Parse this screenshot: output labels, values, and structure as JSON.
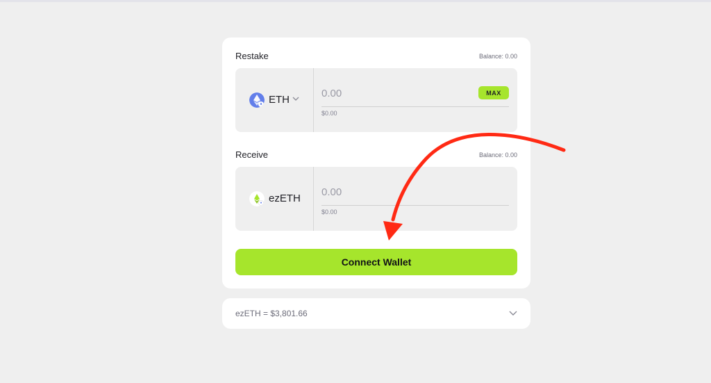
{
  "restake": {
    "label": "Restake",
    "balance": "Balance: 0.00",
    "token": "ETH",
    "token_icon": "ethereum-icon",
    "amount": "0.00",
    "usd": "$0.00",
    "max_label": "MAX"
  },
  "receive": {
    "label": "Receive",
    "balance": "Balance: 0.00",
    "token": "ezETH",
    "token_icon": "ezeth-icon",
    "amount": "0.00",
    "usd": "$0.00"
  },
  "connect_label": "Connect Wallet",
  "rate": {
    "text": "ezETH = $3,801.66"
  },
  "colors": {
    "accent": "#a6e52c",
    "annotation_arrow": "#ff2a14",
    "eth_icon": "#627eea"
  }
}
